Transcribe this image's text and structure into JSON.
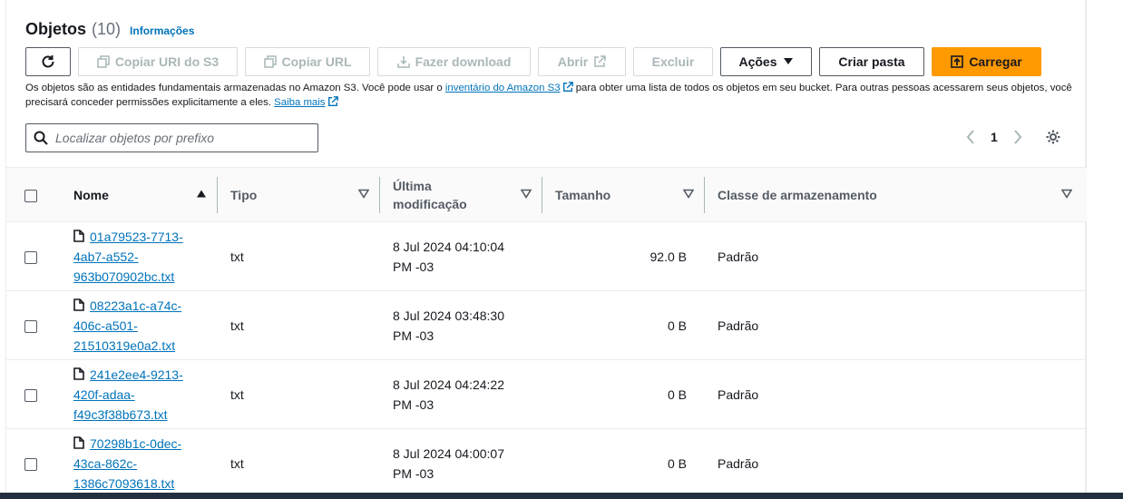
{
  "header": {
    "title": "Objetos",
    "count": "(10)",
    "info": "Informações"
  },
  "toolbar": {
    "copy_uri": "Copiar URI do S3",
    "copy_url": "Copiar URL",
    "download": "Fazer download",
    "open": "Abrir",
    "delete": "Excluir",
    "actions": "Ações",
    "create_folder": "Criar pasta",
    "upload": "Carregar"
  },
  "description": {
    "part1": "Os objetos são as entidades fundamentais armazenadas no Amazon S3. Você pode usar o ",
    "link1": "inventário do Amazon S3",
    "part2": " para obter uma lista de todos os objetos em seu bucket. Para outras pessoas acessarem seus objetos, você precisará conceder permissões explicitamente a eles. ",
    "link2": "Saiba mais"
  },
  "search": {
    "placeholder": "Localizar objetos por prefixo"
  },
  "pagination": {
    "page": "1"
  },
  "table": {
    "headers": {
      "name": "Nome",
      "type": "Tipo",
      "modified_line1": "Última",
      "modified_line2": "modificação",
      "size": "Tamanho",
      "storage_class": "Classe de armazenamento"
    },
    "rows": [
      {
        "name": "01a79523-7713-4ab7-a552-963b070902bc.txt",
        "type": "txt",
        "modified_line1": "8 Jul 2024 04:10:04",
        "modified_line2": "PM -03",
        "size": "92.0 B",
        "storage_class": "Padrão"
      },
      {
        "name": "08223a1c-a74c-406c-a501-21510319e0a2.txt",
        "type": "txt",
        "modified_line1": "8 Jul 2024 03:48:30",
        "modified_line2": "PM -03",
        "size": "0 B",
        "storage_class": "Padrão"
      },
      {
        "name": "241e2ee4-9213-420f-adaa-f49c3f38b673.txt",
        "type": "txt",
        "modified_line1": "8 Jul 2024 04:24:22",
        "modified_line2": "PM -03",
        "size": "0 B",
        "storage_class": "Padrão"
      },
      {
        "name": "70298b1c-0dec-43ca-862c-1386c7093618.txt",
        "type": "txt",
        "modified_line1": "8 Jul 2024 04:00:07",
        "modified_line2": "PM -03",
        "size": "0 B",
        "storage_class": "Padrão"
      }
    ]
  },
  "colors": {
    "link": "#0073bb",
    "primary": "#ff9900",
    "text": "#16191f",
    "muted": "#545b64"
  },
  "icons": [
    "refresh-icon",
    "copy-icon",
    "download-icon",
    "external-link-icon",
    "caret-down-icon",
    "upload-icon",
    "search-icon",
    "chevron-left-icon",
    "chevron-right-icon",
    "gear-icon",
    "file-icon",
    "sort-ascending-icon",
    "sort-descending-icon"
  ]
}
